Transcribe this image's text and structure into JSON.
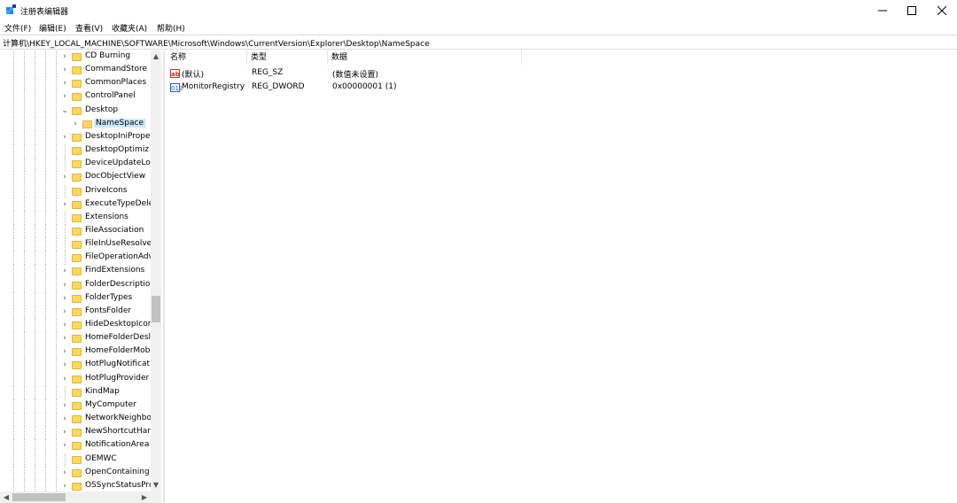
{
  "window": {
    "title": "注册表编辑器"
  },
  "menu": [
    {
      "label": "文件(F)"
    },
    {
      "label": "编辑(E)"
    },
    {
      "label": "查看(V)"
    },
    {
      "label": "收藏夹(A)"
    },
    {
      "label": "帮助(H)"
    }
  ],
  "address": {
    "path": "计算机\\HKEY_LOCAL_MACHINE\\SOFTWARE\\Microsoft\\Windows\\CurrentVersion\\Explorer\\Desktop\\NameSpace"
  },
  "tree": {
    "items": [
      {
        "label": "CD Burning"
      },
      {
        "label": "CommandStore"
      },
      {
        "label": "CommonPlaces"
      },
      {
        "label": "ControlPanel"
      },
      {
        "label": "Desktop"
      },
      {
        "label": "NameSpace"
      },
      {
        "label": "DesktopIniPrope"
      },
      {
        "label": "DesktopOptimiz"
      },
      {
        "label": "DeviceUpdateLo"
      },
      {
        "label": "DocObjectView"
      },
      {
        "label": "DriveIcons"
      },
      {
        "label": "ExecuteTypeDele"
      },
      {
        "label": "Extensions"
      },
      {
        "label": "FileAssociation"
      },
      {
        "label": "FileInUseResolve"
      },
      {
        "label": "FileOperationAdv"
      },
      {
        "label": "FindExtensions"
      },
      {
        "label": "FolderDescriptio"
      },
      {
        "label": "FolderTypes"
      },
      {
        "label": "FontsFolder"
      },
      {
        "label": "HideDesktopIcor"
      },
      {
        "label": "HomeFolderDesl"
      },
      {
        "label": "HomeFolderMob"
      },
      {
        "label": "HotPlugNotificat"
      },
      {
        "label": "HotPlugProvider"
      },
      {
        "label": "KindMap"
      },
      {
        "label": "MyComputer"
      },
      {
        "label": "NetworkNeighbo"
      },
      {
        "label": "NewShortcutHan"
      },
      {
        "label": "NotificationArea"
      },
      {
        "label": "OEMWC"
      },
      {
        "label": "OpenContaining"
      },
      {
        "label": "OSSyncStatusPrc"
      }
    ]
  },
  "values_pane": {
    "columns": {
      "name": "名称",
      "type": "类型",
      "data": "数据"
    },
    "rows": [
      {
        "name": "(默认)",
        "type": "REG_SZ",
        "data": "(数值未设置)",
        "icon": "string-value-icon"
      },
      {
        "name": "MonitorRegistry",
        "type": "REG_DWORD",
        "data": "0x00000001 (1)",
        "icon": "dword-value-icon"
      }
    ]
  },
  "colors": {
    "selection": "#cce8ff",
    "folder": "#f9d866"
  }
}
